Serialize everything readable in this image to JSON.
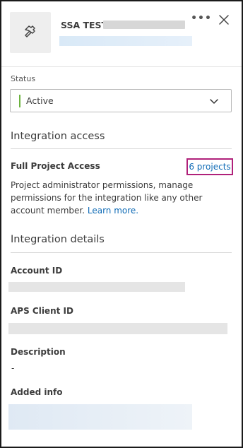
{
  "header": {
    "app_name": "SSA TEST",
    "more_label": "•••",
    "icon": "hammer-icon"
  },
  "status": {
    "label": "Status",
    "value": "Active",
    "status_color": "#6cb33f"
  },
  "integration_access": {
    "title": "Integration access",
    "access_label": "Full Project Access",
    "projects_link": "6 projects",
    "description": "Project administrator permissions, manage permissions for the integration like any other account member.",
    "learn_more": "Learn more."
  },
  "integration_details": {
    "title": "Integration details",
    "account_id_label": "Account ID",
    "aps_client_id_label": "APS Client ID",
    "description_label": "Description",
    "description_value": "-",
    "added_info_label": "Added info"
  },
  "colors": {
    "link": "#0f6bb6",
    "highlight_border": "#b0217a"
  }
}
